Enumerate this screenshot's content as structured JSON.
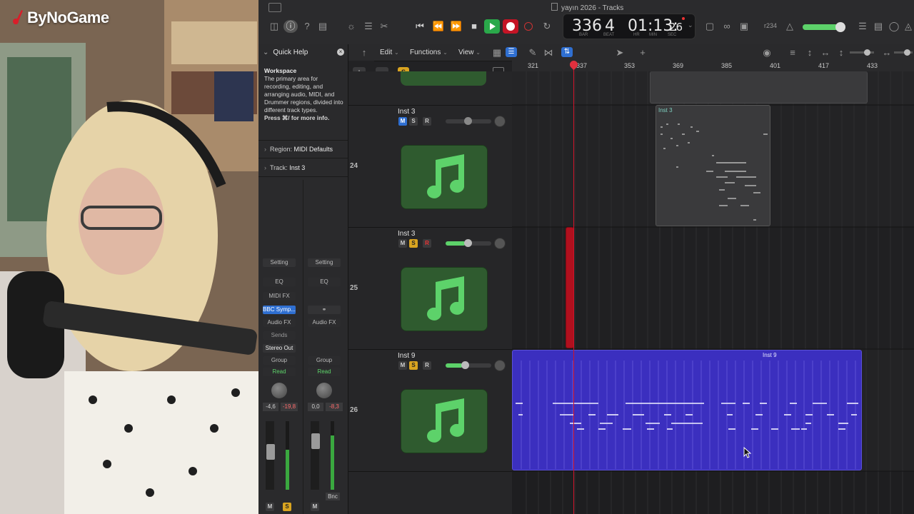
{
  "overlay": {
    "logo_text": "ByNoGame"
  },
  "window": {
    "title": "yayın 2026 - Tracks"
  },
  "transport": {
    "bar": "336",
    "beat": "4",
    "bar_label": "BAR",
    "beat_label": "BEAT",
    "time": "01:13:",
    "time_small": "26",
    "hr_label": "HR",
    "min_label": "MIN",
    "sec_label": "SEC",
    "cpu": "r234"
  },
  "toolbar": {
    "edit": "Edit",
    "functions": "Functions",
    "view": "View"
  },
  "quick_help": {
    "title": "Quick Help",
    "heading": "Workspace",
    "body": "The primary area for recording, editing, and arranging audio, MIDI, and Drummer regions, divided into different track types.",
    "more": "Press ⌘/ for more info."
  },
  "inspector": {
    "region_label": "Region:",
    "region_value": "MIDI Defaults",
    "track_label": "Track:",
    "track_value": "Inst 3"
  },
  "mixer": {
    "setting": "Setting",
    "eq": "EQ",
    "midi_fx": "MIDI FX",
    "instrument": "BBC Symp...",
    "audio_fx": "Audio FX",
    "sends": "Sends",
    "output": "Stereo Out",
    "group": "Group",
    "automation": "Read",
    "val1": "-4,6",
    "val2": "-19,8",
    "val3": "0,0",
    "val4": "-8,3",
    "bnc": "Bnc",
    "m": "M",
    "s": "S"
  },
  "ruler": {
    "bars": [
      "321",
      "337",
      "353",
      "369",
      "385",
      "401",
      "417",
      "433"
    ]
  },
  "tracks": [
    {
      "number": "24",
      "name": "Inst 3",
      "m": "M",
      "s": "S",
      "r": "R",
      "region_name": "Inst 3"
    },
    {
      "number": "25",
      "name": "Inst 3",
      "m": "M",
      "s": "S",
      "r": "R"
    },
    {
      "number": "26",
      "name": "Inst 9",
      "m": "M",
      "s": "S",
      "r": "R",
      "region_name": "Inst 9"
    }
  ],
  "colors": {
    "accent_green": "#5dd26a",
    "record_red": "#d0142a",
    "region_blue": "#3b2fbf",
    "selected_blue": "#2f6fd1"
  },
  "icons": [
    "music-note-icon",
    "record-icon",
    "play-icon",
    "stop-icon",
    "rewind-icon",
    "fast-forward-icon",
    "cycle-icon",
    "close-icon",
    "chevron-right-icon"
  ]
}
